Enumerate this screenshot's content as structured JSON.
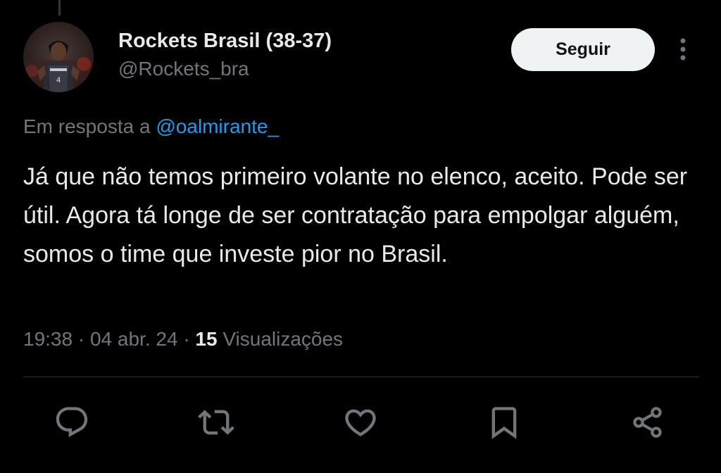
{
  "tweet": {
    "author": {
      "display_name": "Rockets Brasil (38-37)",
      "handle": "@Rockets_bra",
      "avatar_icon": "player-avatar"
    },
    "follow_label": "Seguir",
    "more_icon": "more-vertical-icon",
    "reply_prefix": "Em resposta a",
    "reply_mention": "@oalmirante_",
    "text": "Já que não temos primeiro volante no elenco, aceito. Pode ser útil. Agora tá longe de ser contratação para empolgar alguém, somos o time que investe pior no Brasil.",
    "time": "19:38",
    "separator": "·",
    "date": "04 abr. 24",
    "views_count": "15",
    "views_label": "Visualizações"
  },
  "actions": [
    {
      "name": "reply",
      "icon": "reply-icon"
    },
    {
      "name": "retweet",
      "icon": "retweet-icon"
    },
    {
      "name": "like",
      "icon": "heart-icon"
    },
    {
      "name": "bookmark",
      "icon": "bookmark-icon"
    },
    {
      "name": "share",
      "icon": "share-icon"
    }
  ],
  "colors": {
    "background": "#000000",
    "text": "#e7e9ea",
    "secondary": "#71767b",
    "link": "#1d9bf0",
    "button_bg": "#eff3f4"
  }
}
